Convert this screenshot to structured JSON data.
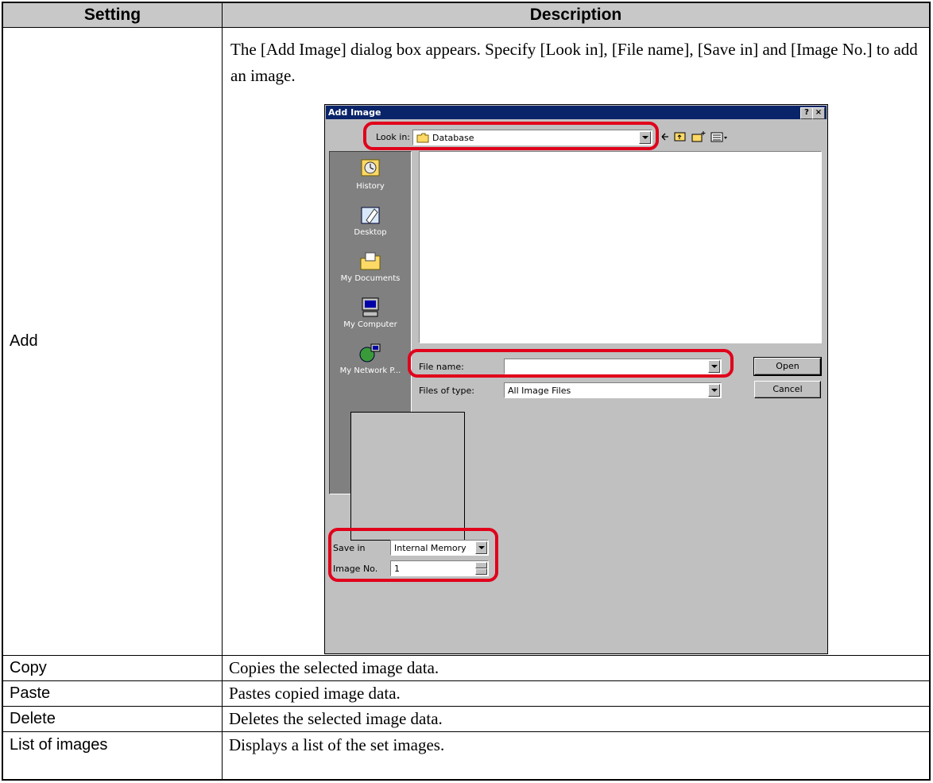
{
  "table": {
    "headers": [
      "Setting",
      "Description"
    ],
    "rows": [
      {
        "setting": "Add",
        "description": "The [Add Image] dialog box appears. Specify [Look in], [File name], [Save in] and [Image No.] to add an image."
      },
      {
        "setting": "Copy",
        "description": "Copies the selected image data."
      },
      {
        "setting": "Paste",
        "description": "Pastes copied image data."
      },
      {
        "setting": "Delete",
        "description": "Deletes the selected image data."
      },
      {
        "setting": "List of images",
        "description": "Displays a list of the set images."
      }
    ]
  },
  "dialog": {
    "title": "Add Image",
    "help_button": "?",
    "close_button": "×",
    "look_in_label": "Look in:",
    "look_in_value": "Database",
    "places": [
      {
        "label": "History",
        "icon": "history-icon"
      },
      {
        "label": "Desktop",
        "icon": "desktop-icon"
      },
      {
        "label": "My Documents",
        "icon": "my-documents-icon"
      },
      {
        "label": "My Computer",
        "icon": "my-computer-icon"
      },
      {
        "label": "My Network P...",
        "icon": "network-places-icon"
      }
    ],
    "file_name_label": "File name:",
    "file_name_value": "",
    "files_of_type_label": "Files of type:",
    "files_of_type_value": "All Image Files",
    "open_button": "Open",
    "cancel_button": "Cancel",
    "save_in_label": "Save in",
    "save_in_value": "Internal Memory",
    "image_no_label": "Image No.",
    "image_no_value": "1",
    "highlight_color": "#e0001b"
  }
}
